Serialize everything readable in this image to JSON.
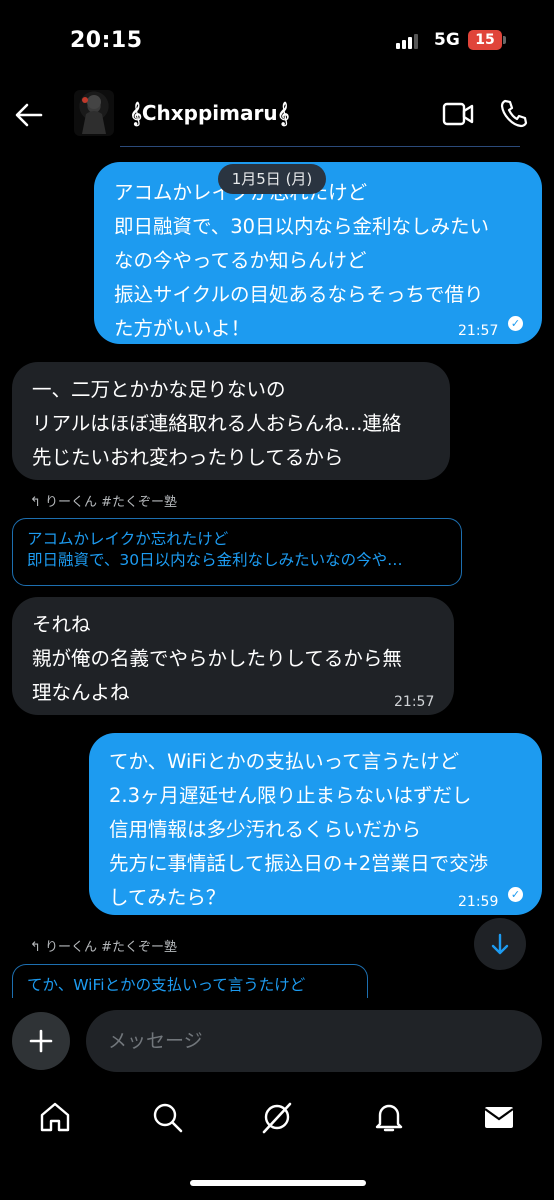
{
  "status_bar": {
    "time": "20:15",
    "network": "5G",
    "battery": "15"
  },
  "header": {
    "username": "𝄞Chxppimaru𝄞"
  },
  "date_separator": "1月5日 (月)",
  "messages": [
    {
      "type": "sent",
      "lines": [
        "アコムかレイクか忘れたけど",
        "即日融資で、30日以内なら金利なしみたい",
        "なの今やってるか知らんけど",
        "振込サイクルの目処あるならそっちで借り",
        "た方がいいよ！"
      ],
      "time": "21:57"
    },
    {
      "type": "received",
      "lines": [
        "一、二万とかかな足りないの",
        "リアルはほぼ連絡取れる人おらんね...連絡",
        "先じたいおれ変わったりしてるから"
      ]
    },
    {
      "type": "received",
      "reply_to": "りーくん #たくぞー塾",
      "quote_lines": [
        "アコムかレイクか忘れたけど",
        "即日融資で、30日以内なら金利なしみたいなの今や…"
      ],
      "lines": [
        "それね",
        "親が俺の名義でやらかしたりしてるから無",
        "理なんよね"
      ],
      "time": "21:57"
    },
    {
      "type": "sent",
      "lines": [
        "てか、WiFiとかの支払いって言うたけど",
        "2.3ヶ月遅延せん限り止まらないはずだし",
        "信用情報は多少汚れるくらいだから",
        "先方に事情話して振込日の+2営業日で交渉",
        "してみたら？"
      ],
      "time": "21:59"
    },
    {
      "type": "received",
      "reply_to": "りーくん #たくぞー塾",
      "quote_lines": [
        "てか、WiFiとかの支払いって言うたけど"
      ]
    }
  ],
  "composer": {
    "placeholder": "メッセージ"
  },
  "icons": {
    "back": "arrow-left-icon",
    "video": "video-call-icon",
    "phone": "phone-call-icon",
    "plus": "plus-icon",
    "scroll": "arrow-down-icon",
    "home": "home-icon",
    "search": "search-icon",
    "grok": "grok-icon",
    "notifications": "bell-icon",
    "messages": "mail-icon"
  },
  "colors": {
    "accent": "#1d9bf0",
    "received_bubble": "#1f2226",
    "battery": "#e0443a"
  }
}
